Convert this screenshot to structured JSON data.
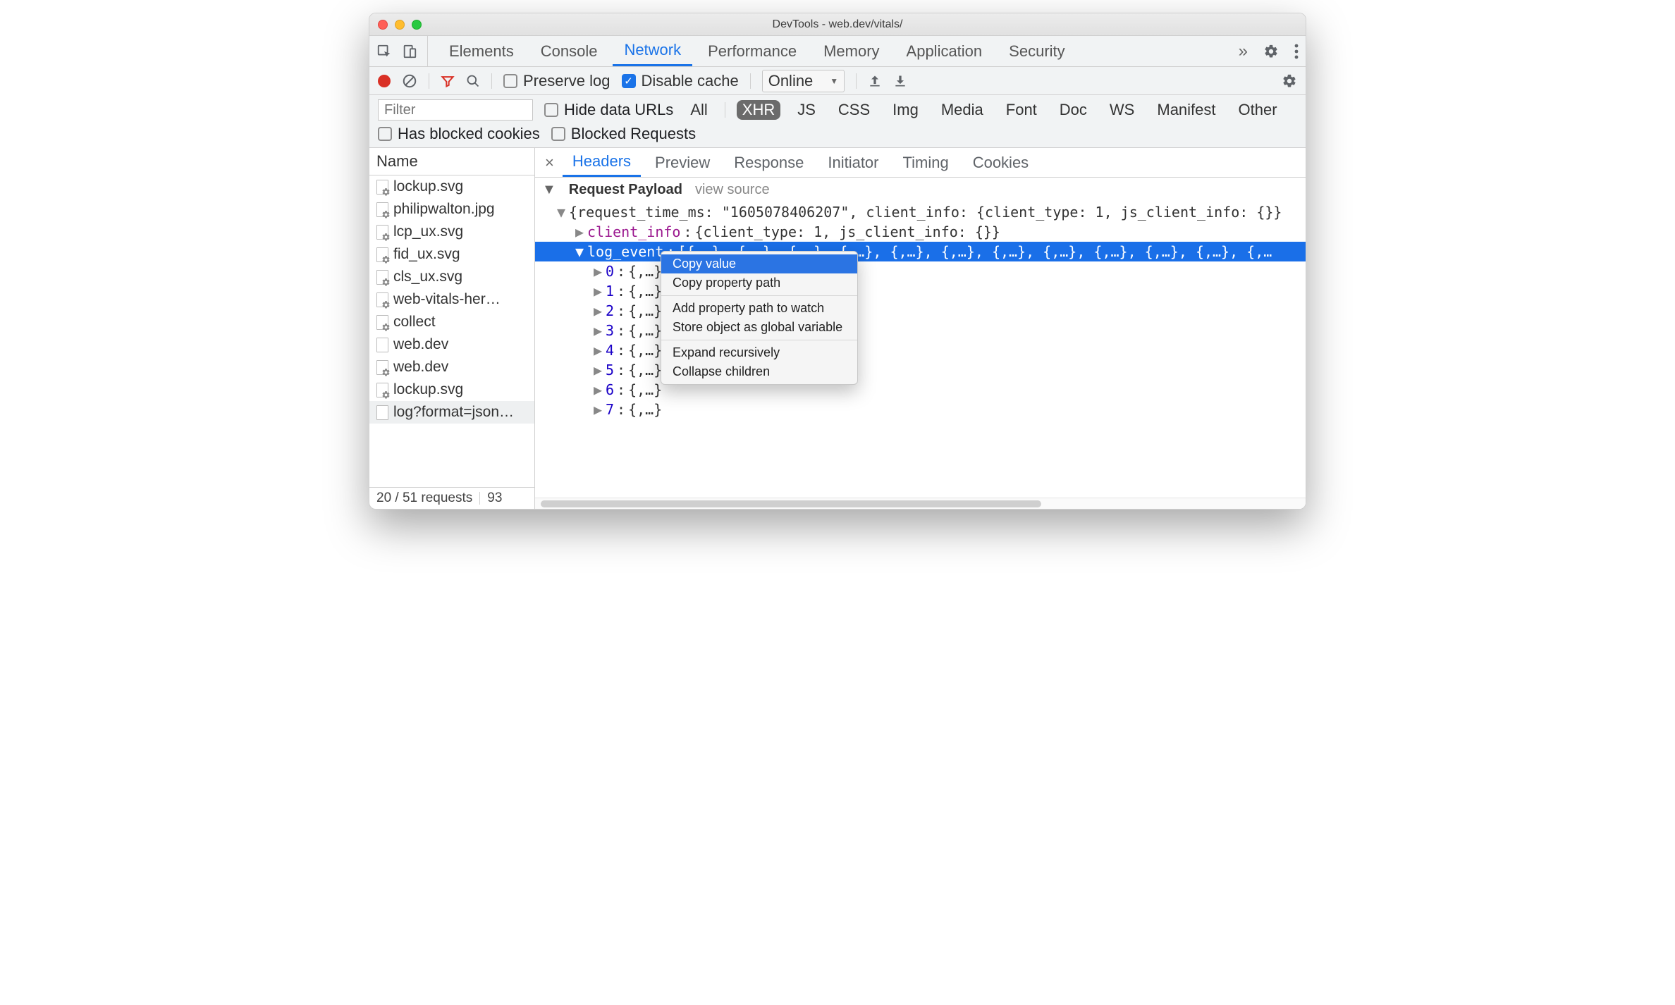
{
  "window": {
    "title": "DevTools - web.dev/vitals/"
  },
  "panel_tabs": {
    "items": [
      "Elements",
      "Console",
      "Network",
      "Performance",
      "Memory",
      "Application",
      "Security"
    ],
    "active": "Network"
  },
  "toolbar": {
    "preserve_log": {
      "label": "Preserve log",
      "checked": false
    },
    "disable_cache": {
      "label": "Disable cache",
      "checked": true
    },
    "throttling": {
      "selected": "Online"
    }
  },
  "filter": {
    "placeholder": "Filter",
    "hide_data_urls": {
      "label": "Hide data URLs",
      "checked": false
    },
    "types": [
      "All",
      "XHR",
      "JS",
      "CSS",
      "Img",
      "Media",
      "Font",
      "Doc",
      "WS",
      "Manifest",
      "Other"
    ],
    "active_type": "XHR",
    "has_blocked_cookies": {
      "label": "Has blocked cookies",
      "checked": false
    },
    "blocked_requests": {
      "label": "Blocked Requests",
      "checked": false
    }
  },
  "sidebar": {
    "header": "Name",
    "items": [
      {
        "name": "lockup.svg",
        "gear": true
      },
      {
        "name": "philipwalton.jpg",
        "gear": true
      },
      {
        "name": "lcp_ux.svg",
        "gear": true
      },
      {
        "name": "fid_ux.svg",
        "gear": true
      },
      {
        "name": "cls_ux.svg",
        "gear": true
      },
      {
        "name": "web-vitals-her…",
        "gear": true
      },
      {
        "name": "collect",
        "gear": true
      },
      {
        "name": "web.dev",
        "gear": false
      },
      {
        "name": "web.dev",
        "gear": true
      },
      {
        "name": "lockup.svg",
        "gear": true
      },
      {
        "name": "log?format=json…",
        "gear": false,
        "selected": true
      }
    ],
    "status": {
      "requests": "20 / 51 requests",
      "extra": "93"
    }
  },
  "detail_tabs": {
    "items": [
      "Headers",
      "Preview",
      "Response",
      "Initiator",
      "Timing",
      "Cookies"
    ],
    "active": "Headers"
  },
  "payload": {
    "section_title": "Request Payload",
    "view_source": "view source",
    "root_summary": "{request_time_ms: \"1605078406207\", client_info: {client_type: 1, js_client_info: {}}",
    "client_info_label": "client_info",
    "client_info_value": "{client_type: 1, js_client_info: {}}",
    "log_event_label": "log_event",
    "log_event_tail": "[{,…}, {,…}, {,…}, {,…}, {,…}, {,…}, {,…}, {,…}, {,…}, {,…}, {,…}, {,…",
    "children": {
      "k0": "0",
      "k1": "1",
      "k2": "2",
      "k3": "3",
      "k4": "4",
      "k5": "5",
      "k6": "6",
      "k7": "7",
      "val": "{,…}"
    }
  },
  "context_menu": {
    "items": {
      "copy_value": "Copy value",
      "copy_property_path": "Copy property path",
      "add_watch": "Add property path to watch",
      "store_global": "Store object as global variable",
      "expand": "Expand recursively",
      "collapse": "Collapse children"
    },
    "active": "copy_value"
  }
}
